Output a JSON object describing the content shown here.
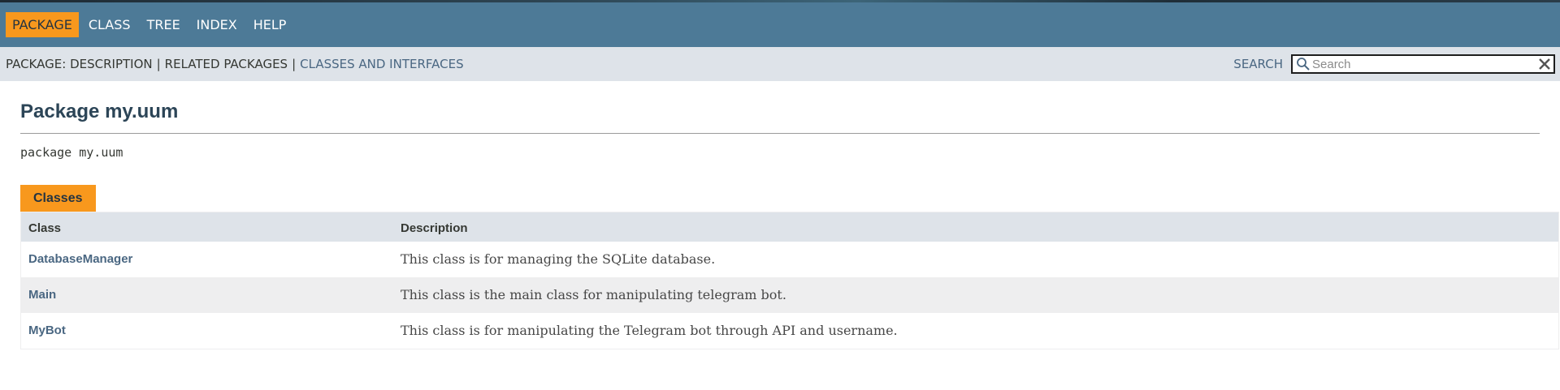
{
  "nav": {
    "items": [
      {
        "label": "PACKAGE",
        "active": true
      },
      {
        "label": "CLASS",
        "active": false
      },
      {
        "label": "TREE",
        "active": false
      },
      {
        "label": "INDEX",
        "active": false
      },
      {
        "label": "HELP",
        "active": false
      }
    ]
  },
  "subnav": {
    "package_label": "PACKAGE:",
    "description": "DESCRIPTION",
    "separator": "|",
    "related": "RELATED PACKAGES",
    "classes_link": "CLASSES AND INTERFACES",
    "search_label": "SEARCH",
    "search_placeholder": "Search",
    "search_value": ""
  },
  "main": {
    "title": "Package my.uum",
    "signature": "package my.uum",
    "tab_label": "Classes",
    "columns": [
      "Class",
      "Description"
    ],
    "rows": [
      {
        "name": "DatabaseManager",
        "description": "This class is for managing the SQLite database."
      },
      {
        "name": "Main",
        "description": "This class is the main class for manipulating telegram bot."
      },
      {
        "name": "MyBot",
        "description": "This class is for manipulating the Telegram bot through API and username."
      }
    ]
  },
  "colors": {
    "nav_bg": "#4d7a97",
    "active_tab": "#f8981d",
    "subnav_bg": "#dee3e9",
    "link": "#4a6782",
    "title": "#2c4557",
    "alt_row": "#eeeeef"
  },
  "icons": {
    "search": "magnifier-icon",
    "reset": "close-x-icon"
  }
}
